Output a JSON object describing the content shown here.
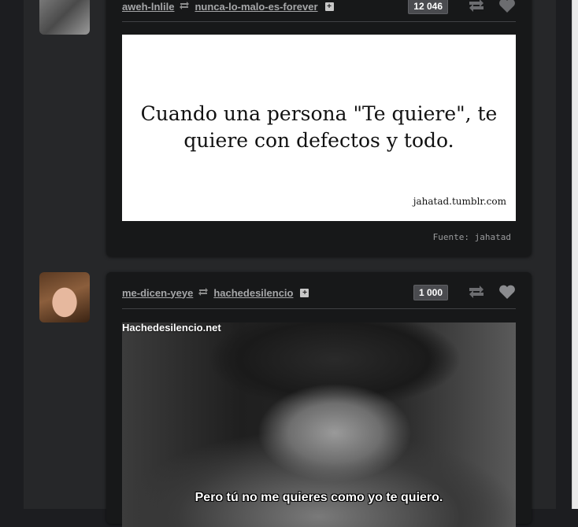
{
  "posts": [
    {
      "poster": "aweh-lnlile",
      "reblogged_from": "nunca-lo-malo-es-forever",
      "notes": "12 046",
      "quote_text": "Cuando una persona \"Te quiere\", te quiere con defectos y todo.",
      "watermark": "jahatad.tumblr.com",
      "source_label": "Fuente:",
      "source_name": "jahatad"
    },
    {
      "poster": "me-dicen-yeye",
      "reblogged_from": "hachedesilencio",
      "notes": "1 000",
      "watermark": "Hachedesilencio.net",
      "subtitle": "Pero tú no me quieres como yo te quiero."
    }
  ],
  "icons": {
    "reblog": "reblog-icon",
    "plus": "plus-icon",
    "like": "heart-icon"
  },
  "colors": {
    "dashboard_bg": "#1c1d20",
    "post_bg": "#171819",
    "link": "#a6a7a9",
    "note_badge": "#4a4b4f"
  }
}
